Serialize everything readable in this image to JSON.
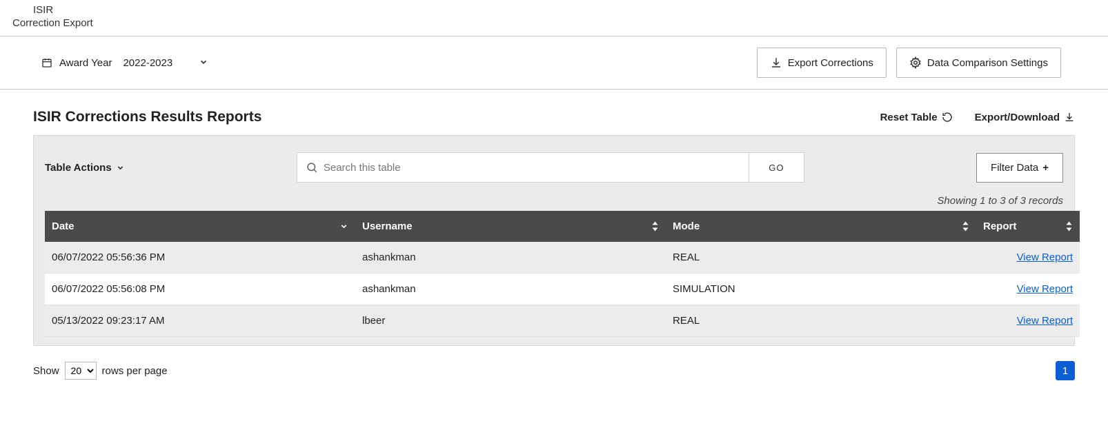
{
  "header": {
    "line1": "ISIR",
    "line2": "Correction Export"
  },
  "subbar": {
    "award_year_label": "Award Year",
    "award_year_value": "2022-2023",
    "export_corrections": "Export Corrections",
    "data_comparison_settings": "Data Comparison Settings"
  },
  "section": {
    "title": "ISIR Corrections Results Reports",
    "reset_table": "Reset Table",
    "export_download": "Export/Download"
  },
  "table_controls": {
    "table_actions": "Table Actions",
    "search_placeholder": "Search this table",
    "go_label": "GO",
    "filter_data": "Filter Data",
    "records_status": "Showing 1 to 3 of 3 records"
  },
  "columns": {
    "date": "Date",
    "username": "Username",
    "mode": "Mode",
    "report": "Report"
  },
  "rows": [
    {
      "date": "06/07/2022 05:56:36 PM",
      "username": "ashankman",
      "mode": "REAL",
      "report_label": "View Report"
    },
    {
      "date": "06/07/2022 05:56:08 PM",
      "username": "ashankman",
      "mode": "SIMULATION",
      "report_label": "View Report"
    },
    {
      "date": "05/13/2022 09:23:17 AM",
      "username": "lbeer",
      "mode": "REAL",
      "report_label": "View Report"
    }
  ],
  "pagination": {
    "show_label": "Show",
    "rows_label": "rows per page",
    "rows_value": "20",
    "current_page": "1"
  }
}
